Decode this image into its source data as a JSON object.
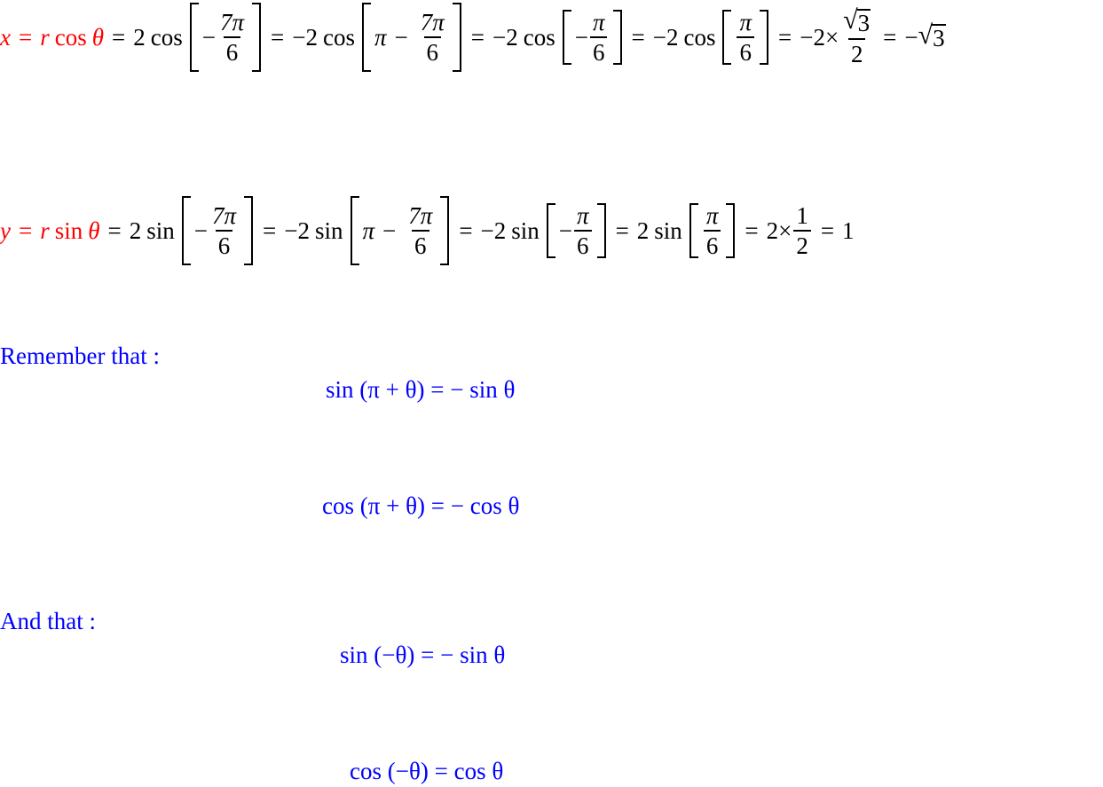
{
  "colors": {
    "variable": "#ff0000",
    "note": "#0000ff",
    "body": "#000000"
  },
  "x_equation": {
    "lhs": {
      "var": "x",
      "eq": "=",
      "r": "r",
      "fn": "cos",
      "theta": "θ"
    },
    "steps": [
      {
        "coef": "2",
        "fn": "cos",
        "bracket": "[ −7π/6 ]"
      },
      {
        "coef": "−2",
        "fn": "cos",
        "bracket": "[ π − 7π/6 ]"
      },
      {
        "coef": "−2",
        "fn": "cos",
        "bracket": "[ −π/6 ]"
      },
      {
        "coef": "−2",
        "fn": "cos",
        "bracket": "[ π/6 ]"
      },
      {
        "expr": "−2 × √3/2"
      },
      {
        "expr": "−√3"
      }
    ],
    "t": {
      "two": "2",
      "neg2": "−2",
      "cos": "cos",
      "minus": "−",
      "pi": "π",
      "seven_pi": "7π",
      "six": "6",
      "eq": "=",
      "times": "×",
      "three": "3",
      "radical": "√"
    }
  },
  "y_equation": {
    "lhs": {
      "var": "y",
      "eq": "=",
      "r": "r",
      "fn": "sin",
      "theta": "θ"
    },
    "steps": [
      {
        "coef": "2",
        "fn": "sin",
        "bracket": "[ −7π/6 ]"
      },
      {
        "coef": "−2",
        "fn": "sin",
        "bracket": "[ π − 7π/6 ]"
      },
      {
        "coef": "−2",
        "fn": "sin",
        "bracket": "[ −π/6 ]"
      },
      {
        "coef": "2",
        "fn": "sin",
        "bracket": "[ π/6 ]"
      },
      {
        "expr": "2 × 1/2"
      },
      {
        "expr": "1"
      }
    ],
    "t": {
      "two": "2",
      "neg2": "−2",
      "sin": "sin",
      "minus": "−",
      "pi": "π",
      "seven_pi": "7π",
      "six": "6",
      "eq": "=",
      "times": "×",
      "one": "1"
    }
  },
  "notes": {
    "remember": "Remember that :",
    "and_that": "And that :"
  },
  "identities": [
    {
      "text": "sin (π + θ) = − sin θ"
    },
    {
      "text": "cos (π + θ) = − cos θ"
    },
    {
      "text": "sin (−θ) = − sin θ"
    },
    {
      "text": "cos (−θ) = cos θ"
    }
  ]
}
